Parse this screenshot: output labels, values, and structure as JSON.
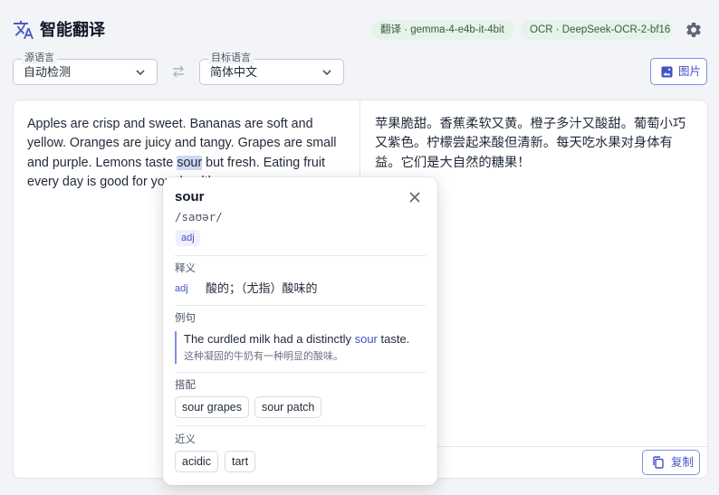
{
  "header": {
    "app_title": "智能翻译",
    "translate_model": "翻译 · gemma-4-e4b-it-4bit",
    "ocr_model": "OCR · DeepSeek-OCR-2-bf16"
  },
  "languages": {
    "source_label": "源语言",
    "source_value": "自动检测",
    "target_label": "目标语言",
    "target_value": "简体中文"
  },
  "image_button_label": "图片",
  "source": {
    "before": "Apples are crisp and sweet. Bananas are soft and yellow. Oranges are juicy and tangy. Grapes are small and purple. Lemons taste ",
    "highlight": "sour",
    "after": " but fresh. Eating fruit every day is good for your health."
  },
  "target_text": "苹果脆甜。香蕉柔软又黄。橙子多汁又酸甜。葡萄小巧又紫色。柠檬尝起来酸但清新。每天吃水果对身体有益。它们是大自然的糖果！",
  "copy_button_label": "复制",
  "popup": {
    "word": "sour",
    "phonetic": "/saʊər/",
    "pos": "adj",
    "definition_label": "释义",
    "definition_pos": "adj",
    "definition": "酸的；（尤指）酸味的",
    "example_label": "例句",
    "example_before": "The curdled milk had a distinctly ",
    "example_word": "sour",
    "example_after": " taste.",
    "example_translation": "这种凝固的牛奶有一种明显的酸味。",
    "collocation_label": "搭配",
    "collocations": [
      "sour grapes",
      "sour patch"
    ],
    "synonym_label": "近义",
    "synonyms": [
      "acidic",
      "tart"
    ]
  }
}
